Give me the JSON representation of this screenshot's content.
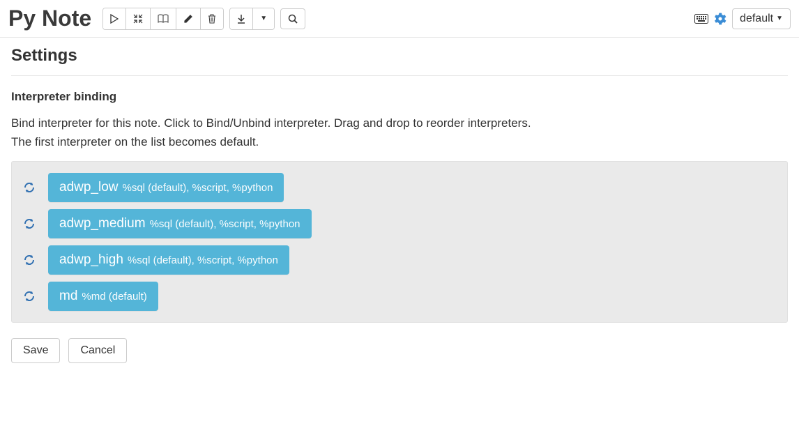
{
  "header": {
    "title": "Py Note",
    "default_dropdown": "default"
  },
  "settings": {
    "heading": "Settings",
    "subheading": "Interpreter binding",
    "instructions_line1": "Bind interpreter for this note. Click to Bind/Unbind interpreter. Drag and drop to reorder interpreters.",
    "instructions_line2": "The first interpreter on the list becomes default.",
    "interpreters": [
      {
        "name": "adwp_low",
        "detail": "%sql (default), %script, %python"
      },
      {
        "name": "adwp_medium",
        "detail": "%sql (default), %script, %python"
      },
      {
        "name": "adwp_high",
        "detail": "%sql (default), %script, %python"
      },
      {
        "name": "md",
        "detail": "%md (default)"
      }
    ],
    "save_label": "Save",
    "cancel_label": "Cancel"
  }
}
